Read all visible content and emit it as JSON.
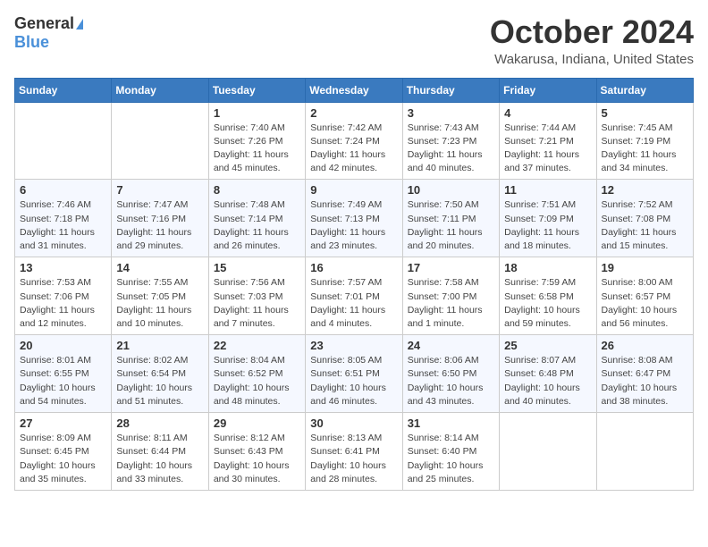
{
  "logo": {
    "general": "General",
    "blue": "Blue"
  },
  "header": {
    "month": "October 2024",
    "location": "Wakarusa, Indiana, United States"
  },
  "weekdays": [
    "Sunday",
    "Monday",
    "Tuesday",
    "Wednesday",
    "Thursday",
    "Friday",
    "Saturday"
  ],
  "weeks": [
    [
      {
        "day": "",
        "sunrise": "",
        "sunset": "",
        "daylight": ""
      },
      {
        "day": "",
        "sunrise": "",
        "sunset": "",
        "daylight": ""
      },
      {
        "day": "1",
        "sunrise": "Sunrise: 7:40 AM",
        "sunset": "Sunset: 7:26 PM",
        "daylight": "Daylight: 11 hours and 45 minutes."
      },
      {
        "day": "2",
        "sunrise": "Sunrise: 7:42 AM",
        "sunset": "Sunset: 7:24 PM",
        "daylight": "Daylight: 11 hours and 42 minutes."
      },
      {
        "day": "3",
        "sunrise": "Sunrise: 7:43 AM",
        "sunset": "Sunset: 7:23 PM",
        "daylight": "Daylight: 11 hours and 40 minutes."
      },
      {
        "day": "4",
        "sunrise": "Sunrise: 7:44 AM",
        "sunset": "Sunset: 7:21 PM",
        "daylight": "Daylight: 11 hours and 37 minutes."
      },
      {
        "day": "5",
        "sunrise": "Sunrise: 7:45 AM",
        "sunset": "Sunset: 7:19 PM",
        "daylight": "Daylight: 11 hours and 34 minutes."
      }
    ],
    [
      {
        "day": "6",
        "sunrise": "Sunrise: 7:46 AM",
        "sunset": "Sunset: 7:18 PM",
        "daylight": "Daylight: 11 hours and 31 minutes."
      },
      {
        "day": "7",
        "sunrise": "Sunrise: 7:47 AM",
        "sunset": "Sunset: 7:16 PM",
        "daylight": "Daylight: 11 hours and 29 minutes."
      },
      {
        "day": "8",
        "sunrise": "Sunrise: 7:48 AM",
        "sunset": "Sunset: 7:14 PM",
        "daylight": "Daylight: 11 hours and 26 minutes."
      },
      {
        "day": "9",
        "sunrise": "Sunrise: 7:49 AM",
        "sunset": "Sunset: 7:13 PM",
        "daylight": "Daylight: 11 hours and 23 minutes."
      },
      {
        "day": "10",
        "sunrise": "Sunrise: 7:50 AM",
        "sunset": "Sunset: 7:11 PM",
        "daylight": "Daylight: 11 hours and 20 minutes."
      },
      {
        "day": "11",
        "sunrise": "Sunrise: 7:51 AM",
        "sunset": "Sunset: 7:09 PM",
        "daylight": "Daylight: 11 hours and 18 minutes."
      },
      {
        "day": "12",
        "sunrise": "Sunrise: 7:52 AM",
        "sunset": "Sunset: 7:08 PM",
        "daylight": "Daylight: 11 hours and 15 minutes."
      }
    ],
    [
      {
        "day": "13",
        "sunrise": "Sunrise: 7:53 AM",
        "sunset": "Sunset: 7:06 PM",
        "daylight": "Daylight: 11 hours and 12 minutes."
      },
      {
        "day": "14",
        "sunrise": "Sunrise: 7:55 AM",
        "sunset": "Sunset: 7:05 PM",
        "daylight": "Daylight: 11 hours and 10 minutes."
      },
      {
        "day": "15",
        "sunrise": "Sunrise: 7:56 AM",
        "sunset": "Sunset: 7:03 PM",
        "daylight": "Daylight: 11 hours and 7 minutes."
      },
      {
        "day": "16",
        "sunrise": "Sunrise: 7:57 AM",
        "sunset": "Sunset: 7:01 PM",
        "daylight": "Daylight: 11 hours and 4 minutes."
      },
      {
        "day": "17",
        "sunrise": "Sunrise: 7:58 AM",
        "sunset": "Sunset: 7:00 PM",
        "daylight": "Daylight: 11 hours and 1 minute."
      },
      {
        "day": "18",
        "sunrise": "Sunrise: 7:59 AM",
        "sunset": "Sunset: 6:58 PM",
        "daylight": "Daylight: 10 hours and 59 minutes."
      },
      {
        "day": "19",
        "sunrise": "Sunrise: 8:00 AM",
        "sunset": "Sunset: 6:57 PM",
        "daylight": "Daylight: 10 hours and 56 minutes."
      }
    ],
    [
      {
        "day": "20",
        "sunrise": "Sunrise: 8:01 AM",
        "sunset": "Sunset: 6:55 PM",
        "daylight": "Daylight: 10 hours and 54 minutes."
      },
      {
        "day": "21",
        "sunrise": "Sunrise: 8:02 AM",
        "sunset": "Sunset: 6:54 PM",
        "daylight": "Daylight: 10 hours and 51 minutes."
      },
      {
        "day": "22",
        "sunrise": "Sunrise: 8:04 AM",
        "sunset": "Sunset: 6:52 PM",
        "daylight": "Daylight: 10 hours and 48 minutes."
      },
      {
        "day": "23",
        "sunrise": "Sunrise: 8:05 AM",
        "sunset": "Sunset: 6:51 PM",
        "daylight": "Daylight: 10 hours and 46 minutes."
      },
      {
        "day": "24",
        "sunrise": "Sunrise: 8:06 AM",
        "sunset": "Sunset: 6:50 PM",
        "daylight": "Daylight: 10 hours and 43 minutes."
      },
      {
        "day": "25",
        "sunrise": "Sunrise: 8:07 AM",
        "sunset": "Sunset: 6:48 PM",
        "daylight": "Daylight: 10 hours and 40 minutes."
      },
      {
        "day": "26",
        "sunrise": "Sunrise: 8:08 AM",
        "sunset": "Sunset: 6:47 PM",
        "daylight": "Daylight: 10 hours and 38 minutes."
      }
    ],
    [
      {
        "day": "27",
        "sunrise": "Sunrise: 8:09 AM",
        "sunset": "Sunset: 6:45 PM",
        "daylight": "Daylight: 10 hours and 35 minutes."
      },
      {
        "day": "28",
        "sunrise": "Sunrise: 8:11 AM",
        "sunset": "Sunset: 6:44 PM",
        "daylight": "Daylight: 10 hours and 33 minutes."
      },
      {
        "day": "29",
        "sunrise": "Sunrise: 8:12 AM",
        "sunset": "Sunset: 6:43 PM",
        "daylight": "Daylight: 10 hours and 30 minutes."
      },
      {
        "day": "30",
        "sunrise": "Sunrise: 8:13 AM",
        "sunset": "Sunset: 6:41 PM",
        "daylight": "Daylight: 10 hours and 28 minutes."
      },
      {
        "day": "31",
        "sunrise": "Sunrise: 8:14 AM",
        "sunset": "Sunset: 6:40 PM",
        "daylight": "Daylight: 10 hours and 25 minutes."
      },
      {
        "day": "",
        "sunrise": "",
        "sunset": "",
        "daylight": ""
      },
      {
        "day": "",
        "sunrise": "",
        "sunset": "",
        "daylight": ""
      }
    ]
  ]
}
